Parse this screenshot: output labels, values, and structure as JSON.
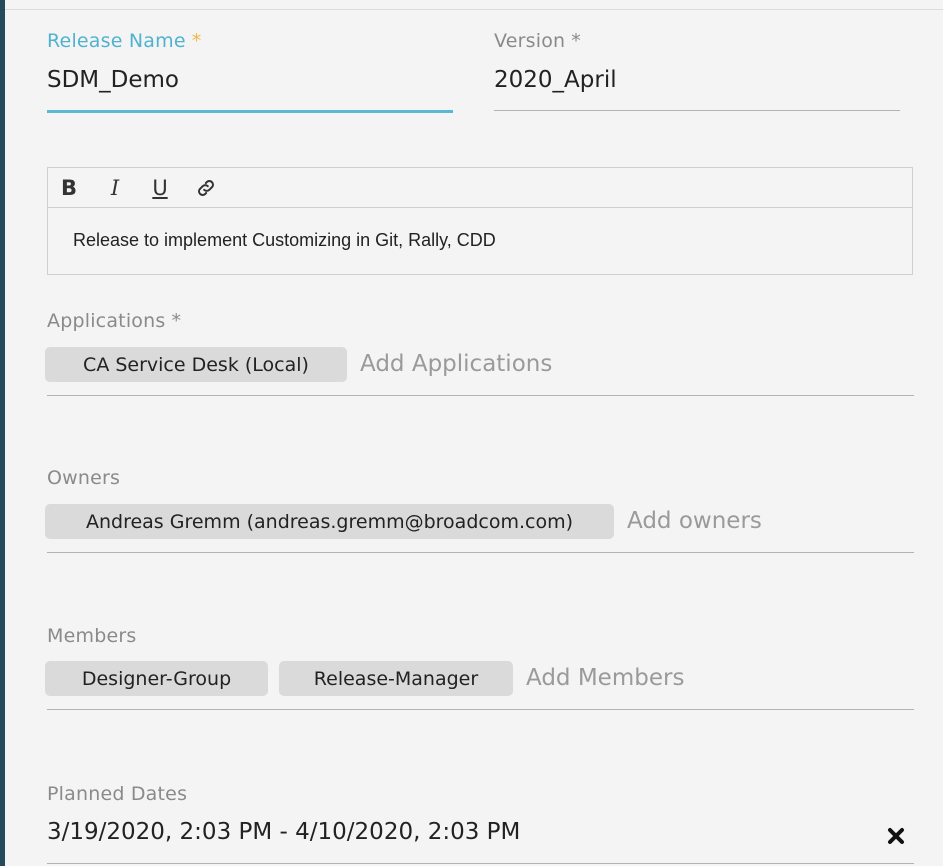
{
  "form": {
    "release_name": {
      "label": "Release Name",
      "required": "*",
      "value": "SDM_Demo"
    },
    "version": {
      "label": "Version",
      "required": "*",
      "value": "2020_April"
    },
    "description": {
      "toolbar": [
        {
          "name": "bold",
          "glyph": "B"
        },
        {
          "name": "italic",
          "glyph": "I"
        },
        {
          "name": "underline",
          "glyph": "U"
        },
        {
          "name": "link",
          "glyph": "link-icon"
        }
      ],
      "text": "Release to implement Customizing in Git, Rally, CDD"
    },
    "applications": {
      "label": "Applications",
      "required": "*",
      "chips": [
        "CA Service Desk (Local)"
      ],
      "placeholder": "Add Applications"
    },
    "owners": {
      "label": "Owners",
      "chips": [
        "Andreas Gremm (andreas.gremm@broadcom.com)"
      ],
      "placeholder": "Add owners"
    },
    "members": {
      "label": "Members",
      "chips": [
        "Designer-Group",
        "Release-Manager"
      ],
      "placeholder": "Add Members"
    },
    "planned_dates": {
      "label": "Planned Dates",
      "value": "3/19/2020, 2:03 PM - 4/10/2020, 2:03 PM",
      "clear_icon": "close-x-icon"
    }
  },
  "colors": {
    "active_label": "#4fb3cf",
    "required_active": "#f0b64a",
    "active_underline": "#5ab8d4",
    "chip_background": "#dadada",
    "left_edge": "#254a5a"
  }
}
